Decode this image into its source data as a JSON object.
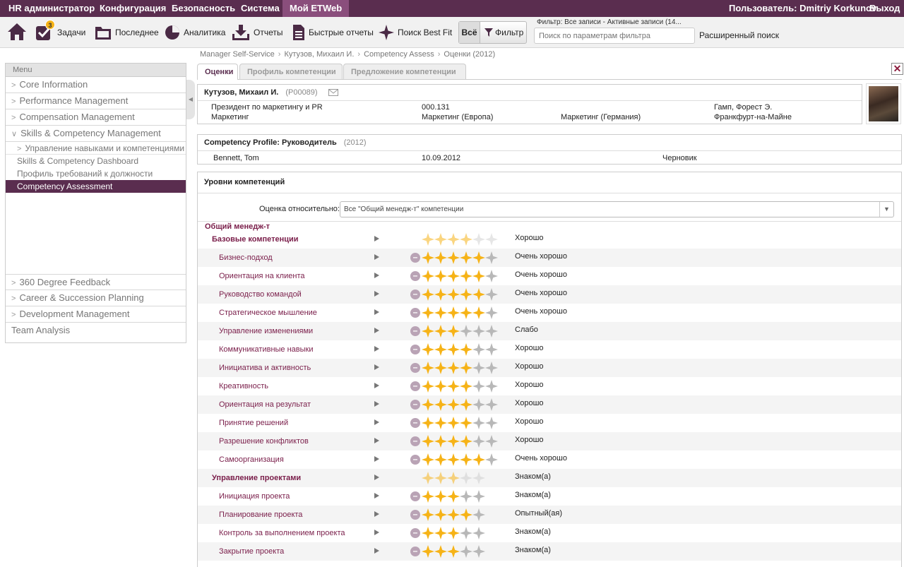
{
  "topbar": {
    "items": [
      "HR администратор",
      "Конфигурация",
      "Безопасность",
      "Система",
      "Мой ETWeb"
    ],
    "active_index": 4,
    "user": "Пользователь: Dmitriy Korkunov",
    "logout": "Выход"
  },
  "toolbar": {
    "home_icon": "home-icon",
    "tasks": {
      "label": "Задачи",
      "badge": "3"
    },
    "recent": "Последнее",
    "analytics": "Аналитика",
    "reports": "Отчеты",
    "quick_reports": "Быстрые отчеты",
    "best_fit": "Поиск Best Fit",
    "all": "Всё",
    "filter": "Фильтр",
    "filter_info": "Фильтр: Все записи - Активные записи (14...",
    "search_placeholder": "Поиск по параметрам фильтра",
    "advanced_search": "Расширенный поиск"
  },
  "breadcrumb": [
    "Manager Self-Service",
    "Кутузов, Михаил И.",
    "Competency Assess",
    "Оценки (2012)"
  ],
  "sidebar": {
    "header": "Menu",
    "items_top": [
      "Core Information",
      "Performance Management",
      "Compensation Management",
      "Skills & Competency Management"
    ],
    "sub_group": "Управление навыками и компетенциями",
    "sub_items": [
      "Skills & Competency Dashboard",
      "Профиль требований к должности",
      "Competency Assessment"
    ],
    "selected_sub": "Competency Assessment",
    "items_bottom": [
      "360 Degree Feedback",
      "Career & Succession Planning",
      "Development Management",
      "Team Analysis"
    ]
  },
  "tabs": [
    "Оценки",
    "Профиль компетенции",
    "Предложение компетенции"
  ],
  "employee": {
    "name": "Кутузов, Михаил И.",
    "code": "(P00089)",
    "position": "Президент по маркетингу и PR",
    "department": "Маркетинг",
    "position_code": "000.131",
    "org1": "Маркетинг (Европа)",
    "org2": "Маркетинг (Германия)",
    "manager": "Гамп, Форест Э.",
    "location": "Франкфурт-на-Майне"
  },
  "profile": {
    "title": "Competency Profile: Руководитель",
    "year": "(2012)",
    "assessor": "Bennett, Tom",
    "date": "10.09.2012",
    "status": "Черновик"
  },
  "levels": {
    "title": "Уровни компетенций",
    "relative_label": "Оценка относительно:",
    "relative_value": "Все \"Общий менедж-т\" компетенции",
    "group": "Общий менедж-т",
    "rows": [
      {
        "label": "Базовые компетенции",
        "bold": true,
        "rating": 4,
        "max": 6,
        "value": "Хорошо"
      },
      {
        "label": "Бизнес-подход",
        "bold": false,
        "rating": 5,
        "max": 6,
        "value": "Очень хорошо"
      },
      {
        "label": "Ориентация на клиента",
        "bold": false,
        "rating": 5,
        "max": 6,
        "value": "Очень хорошо"
      },
      {
        "label": "Руководство командой",
        "bold": false,
        "rating": 5,
        "max": 6,
        "value": "Очень хорошо"
      },
      {
        "label": "Стратегическое мышление",
        "bold": false,
        "rating": 5,
        "max": 6,
        "value": "Очень хорошо"
      },
      {
        "label": "Управление изменениями",
        "bold": false,
        "rating": 3,
        "max": 6,
        "value": "Слабо"
      },
      {
        "label": "Коммуникативные навыки",
        "bold": false,
        "rating": 4,
        "max": 6,
        "value": "Хорошо"
      },
      {
        "label": "Инициатива и активность",
        "bold": false,
        "rating": 4,
        "max": 6,
        "value": "Хорошо"
      },
      {
        "label": "Креативность",
        "bold": false,
        "rating": 4,
        "max": 6,
        "value": "Хорошо"
      },
      {
        "label": "Ориентация на результат",
        "bold": false,
        "rating": 4,
        "max": 6,
        "value": "Хорошо"
      },
      {
        "label": "Принятие решений",
        "bold": false,
        "rating": 4,
        "max": 6,
        "value": "Хорошо"
      },
      {
        "label": "Разрешение конфликтов",
        "bold": false,
        "rating": 4,
        "max": 6,
        "value": "Хорошо"
      },
      {
        "label": "Самоорганизация",
        "bold": false,
        "rating": 5,
        "max": 6,
        "value": "Очень хорошо"
      },
      {
        "label": "Управление проектами",
        "bold": true,
        "rating": 3,
        "max": 5,
        "value": "Знаком(а)"
      },
      {
        "label": "Инициация проекта",
        "bold": false,
        "rating": 3,
        "max": 5,
        "value": "Знаком(а)"
      },
      {
        "label": "Планирование проекта",
        "bold": false,
        "rating": 4,
        "max": 5,
        "value": "Опытный(ая)"
      },
      {
        "label": "Контроль за выполнением проекта",
        "bold": false,
        "rating": 3,
        "max": 5,
        "value": "Знаком(а)"
      },
      {
        "label": "Закрытие проекта",
        "bold": false,
        "rating": 3,
        "max": 5,
        "value": "Знаком(а)"
      }
    ]
  },
  "colors": {
    "brand": "#5a2d4f",
    "link": "#7a1e4a",
    "star_on": "#f6b317",
    "star_off": "#b8b8b8"
  }
}
